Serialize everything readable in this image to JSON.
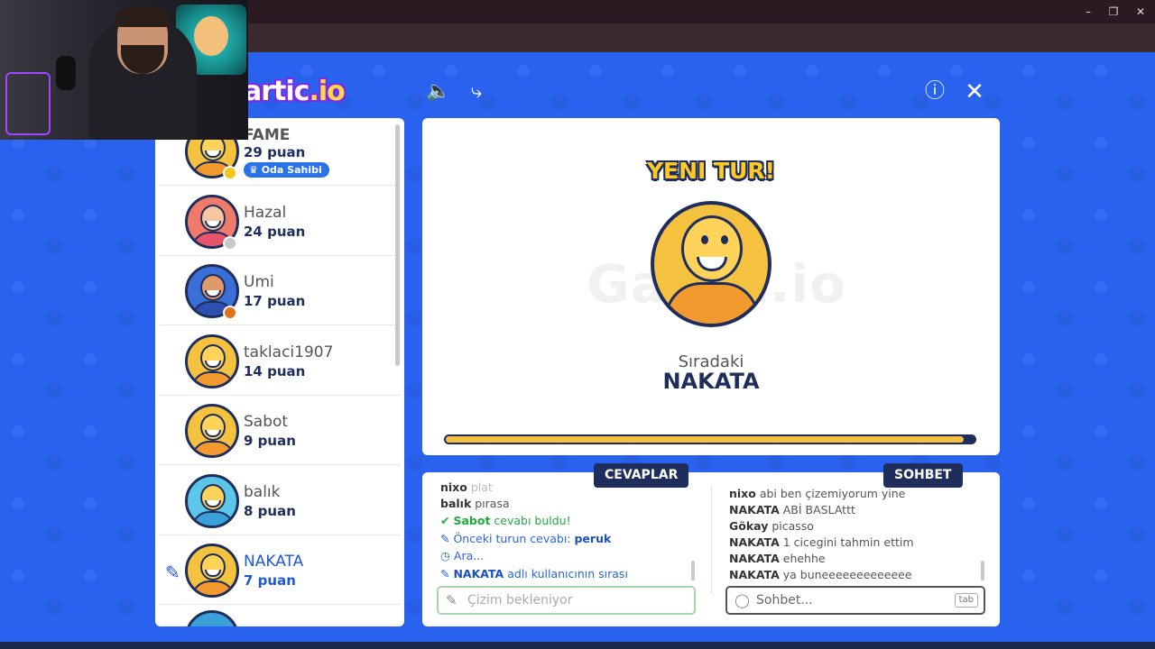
{
  "browser": {
    "window_controls": [
      "–",
      "❐",
      "✕"
    ],
    "toolbar_icons": [
      "cast-icon",
      "star-icon",
      "extensions-icon",
      "media-icon",
      "profile-icon",
      "menu-icon"
    ]
  },
  "header": {
    "logo_main": "artic",
    "logo_suffix": ".io",
    "sound_icon": "🔈",
    "share_icon": "⤷",
    "info_icon": "ⓘ",
    "close_icon": "✕"
  },
  "players": [
    {
      "name": "FAME",
      "score": "29 puan",
      "badge": "Oda Sahibi",
      "status_color": "#f5c518",
      "me": false
    },
    {
      "name": "Hazal",
      "score": "24 puan",
      "status_color": "#c9c9c9",
      "me": false
    },
    {
      "name": "Umi",
      "score": "17 puan",
      "status_color": "#e0721c",
      "me": false
    },
    {
      "name": "taklaci1907",
      "score": "14 puan",
      "me": false
    },
    {
      "name": "Sabot",
      "score": "9 puan",
      "me": false
    },
    {
      "name": "balık",
      "score": "8 puan",
      "me": false
    },
    {
      "name": "NAKATA",
      "score": "7 puan",
      "me": true
    }
  ],
  "stage": {
    "watermark": "Gartic.io",
    "new_round": "YENI TUR!",
    "next_label": "Sıradaki",
    "next_name": "NAKATA",
    "progress": 0.98
  },
  "answers": {
    "tab_label": "CEVAPLAR",
    "messages": [
      {
        "user": "nixo",
        "text": "plat",
        "kind": "faded"
      },
      {
        "user": "balık",
        "text": "pırasa",
        "kind": "normal"
      },
      {
        "icon": "✔",
        "user": "Sabot",
        "text": "cevabı buldu!",
        "kind": "green"
      },
      {
        "icon": "✎",
        "prefix": "Önceki turun cevabı:",
        "answer": "peruk",
        "kind": "blue"
      },
      {
        "icon": "◷",
        "text": "Ara...",
        "kind": "blue"
      },
      {
        "icon": "✎",
        "user": "NAKATA",
        "text": "adlı kullanıcının sırası",
        "kind": "blue"
      }
    ],
    "placeholder": "Çizim bekleniyor"
  },
  "chat": {
    "tab_label": "SOHBET",
    "messages": [
      {
        "user": "nixo",
        "text": "abi ben çizemiyorum yine"
      },
      {
        "user": "NAKATA",
        "text": "ABİ BASLAttt"
      },
      {
        "user": "Gökay",
        "text": "picasso"
      },
      {
        "user": "NAKATA",
        "text": "1 cicegini tahmin ettim"
      },
      {
        "user": "NAKATA",
        "text": "ehehhe"
      },
      {
        "user": "NAKATA",
        "text": "ya buneeeeeeeeeeeee"
      }
    ],
    "placeholder": "Sohbet...",
    "tab_key": "tab"
  }
}
